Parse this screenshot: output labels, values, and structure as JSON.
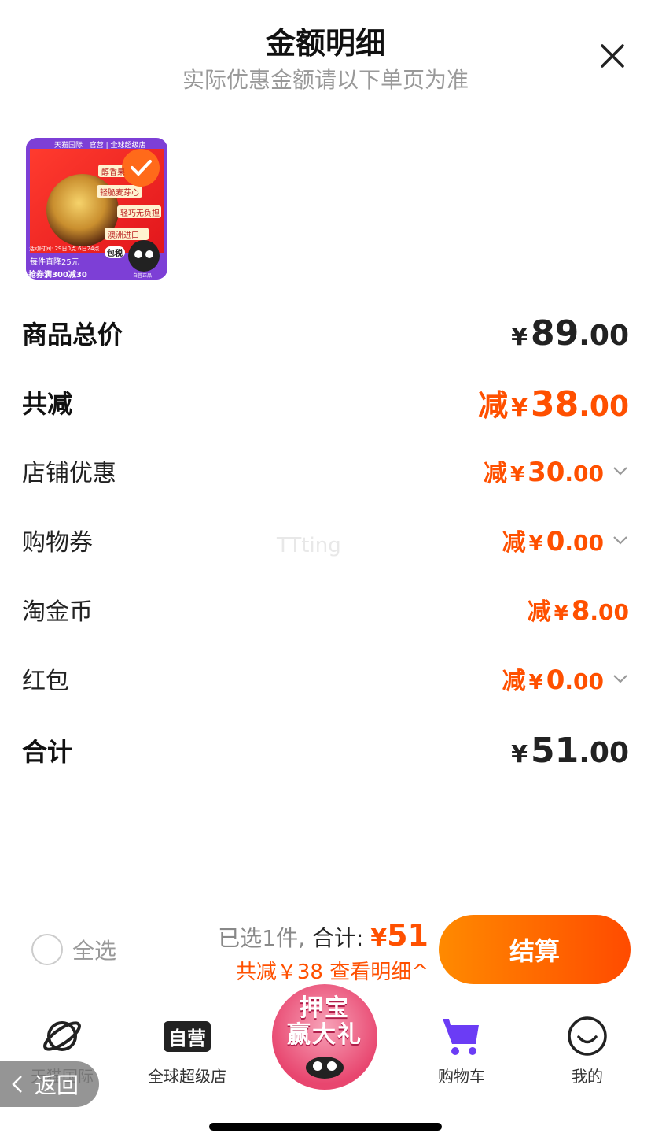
{
  "header": {
    "title": "金额明细",
    "subtitle": "实际优惠金额请以下单页为准"
  },
  "product": {
    "thumb_top_banner": "天猫国际 | 官营 | 全球超级店",
    "tags": [
      "醇香果",
      "轻脆麦芽心",
      "轻巧无负担",
      "澳洲进口"
    ],
    "promo_line1": "每件直降25元",
    "promo_line2": "抢券满300减30",
    "badge": "包税",
    "mascot_caption": "自营正品",
    "date_text": "活动时间: 29日0点 6日24点"
  },
  "rows": [
    {
      "label": "商品总价",
      "prefix": "",
      "yen": "¥",
      "int": "89",
      "dec": ".00",
      "style": "dark",
      "chevron": false
    },
    {
      "label": "共减",
      "prefix": "减",
      "yen": "¥",
      "int": "38",
      "dec": ".00",
      "style": "orange",
      "chevron": false
    },
    {
      "label": "店铺优惠",
      "prefix": "减",
      "yen": "¥",
      "int": "30",
      "dec": ".00",
      "style": "orange",
      "chevron": true
    },
    {
      "label": "购物券",
      "prefix": "减",
      "yen": "¥",
      "int": "0",
      "dec": ".00",
      "style": "orange",
      "chevron": true
    },
    {
      "label": "淘金币",
      "prefix": "减",
      "yen": "¥",
      "int": "8",
      "dec": ".00",
      "style": "orange",
      "chevron": false
    },
    {
      "label": "红包",
      "prefix": "减",
      "yen": "¥",
      "int": "0",
      "dec": ".00",
      "style": "orange",
      "chevron": true
    },
    {
      "label": "合计",
      "prefix": "",
      "yen": "¥",
      "int": "51",
      "dec": ".00",
      "style": "dark",
      "chevron": false
    }
  ],
  "watermark": "TTting",
  "bottom": {
    "select_all": "全选",
    "selected_count": "已选1件,",
    "total_label": "合计:",
    "total_yen": "¥",
    "total_value": "51",
    "discount_detail": "共减￥38 查看明细^",
    "checkout": "结算"
  },
  "tabs": [
    {
      "label": "天猫国际",
      "icon": "planet-icon"
    },
    {
      "label": "全球超级店",
      "icon": "ziying-icon",
      "icon_text": "自营"
    },
    {
      "label": "购物车",
      "icon": "cart-icon"
    },
    {
      "label": "我的",
      "icon": "smile-icon"
    }
  ],
  "promo": {
    "line1": "押宝",
    "line2": "赢大礼"
  },
  "back": "返回",
  "colors": {
    "accent": "#ff5000",
    "cart": "#6b3cf5"
  }
}
